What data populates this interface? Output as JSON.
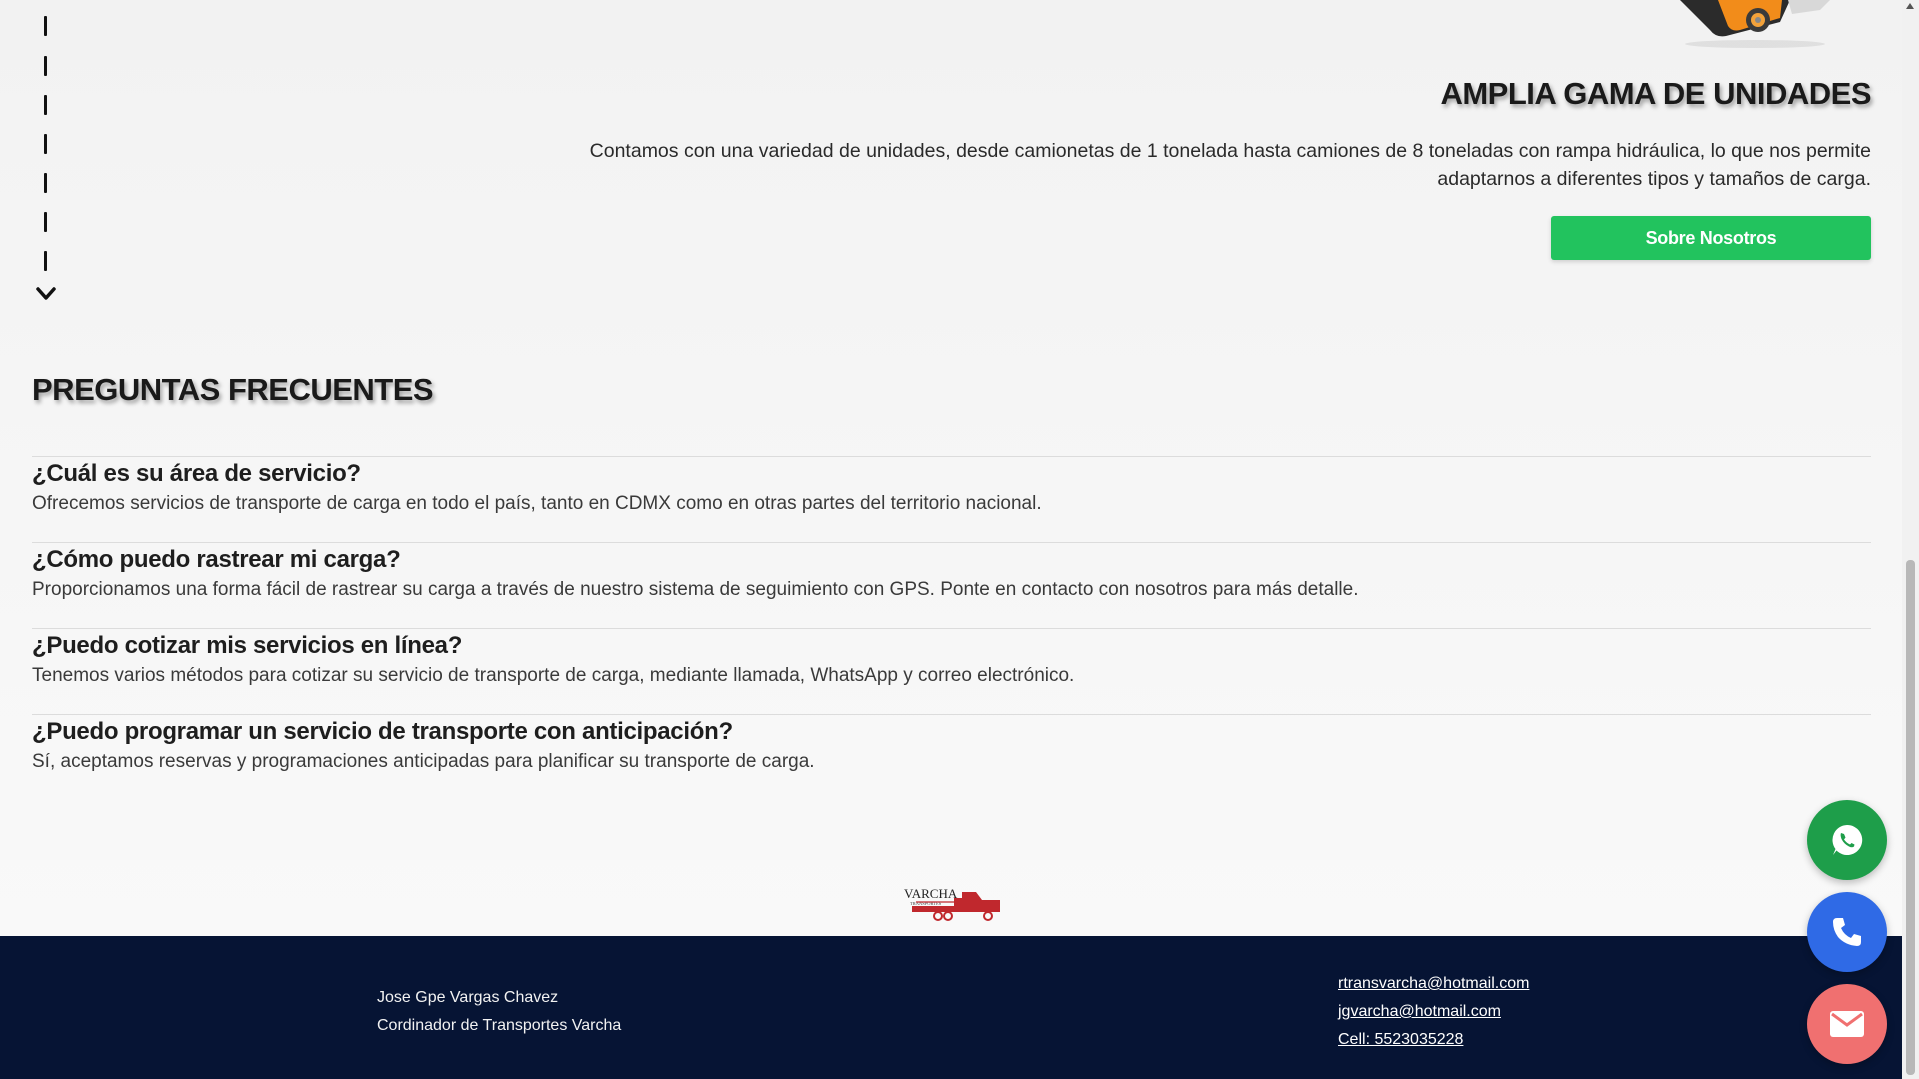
{
  "feature": {
    "title": "AMPLIA GAMA DE UNIDADES",
    "text": "Contamos con una variedad de unidades, desde camionetas de 1 tonelada hasta camiones de 8 toneladas con rampa hidráulica, lo que nos permite adaptarnos a diferentes tipos y tamaños de carga.",
    "button_label": "Sobre Nosotros"
  },
  "faq": {
    "heading": "PREGUNTAS FRECUENTES",
    "items": [
      {
        "question": "¿Cuál es su área de servicio?",
        "answer": "Ofrecemos servicios de transporte de carga en todo el país, tanto en CDMX como en otras partes del territorio nacional."
      },
      {
        "question": "¿Cómo puedo rastrear mi carga?",
        "answer": "Proporcionamos una forma fácil de rastrear su carga a través de nuestro sistema de seguimiento con GPS. Ponte en contacto con nosotros para más detalle."
      },
      {
        "question": "¿Puedo cotizar mis servicios en línea?",
        "answer": "Tenemos varios métodos para cotizar su servicio de transporte de carga, mediante llamada, WhatsApp y correo electrónico."
      },
      {
        "question": "¿Puedo programar un servicio de transporte con anticipación?",
        "answer": "Sí, aceptamos reservas y programaciones anticipadas para planificar su transporte de carga."
      }
    ]
  },
  "logo": {
    "text_main": "VARCHA",
    "text_sub": "TRANSPORTES",
    "color": "#c0282d"
  },
  "footer": {
    "name": "Jose Gpe Vargas Chavez",
    "role": "Cordinador de Transportes Varcha",
    "email1": "rtransvarcha@hotmail.com",
    "email2": "jgvarcha@hotmail.com",
    "cell": "Cell: 5523035228",
    "background": "#061434"
  },
  "fabs": {
    "whatsapp": {
      "icon": "whatsapp-icon",
      "color": "#1e9e4a"
    },
    "phone": {
      "icon": "phone-icon",
      "color": "#2f6ae6"
    },
    "mail": {
      "icon": "mail-icon",
      "color": "#f07070"
    }
  },
  "colors": {
    "button_green": "#22c35e"
  }
}
